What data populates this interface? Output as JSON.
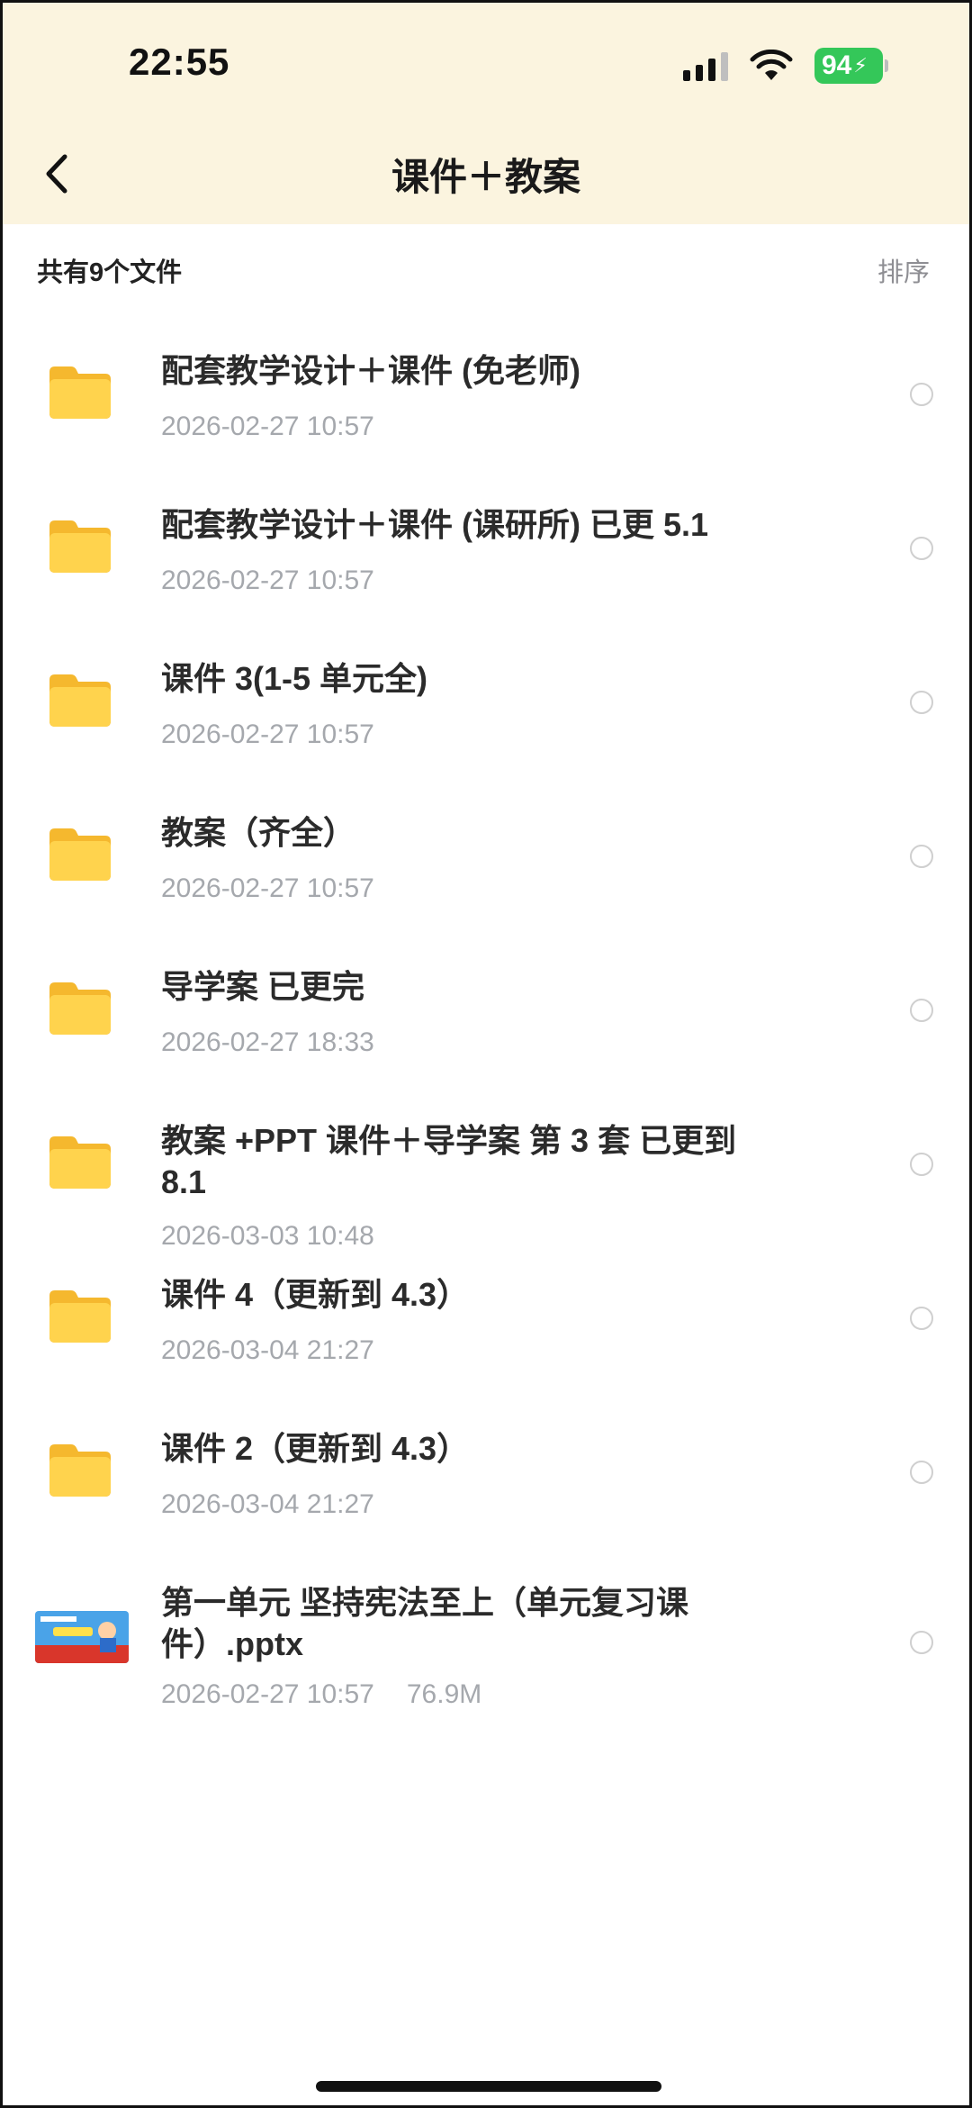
{
  "status": {
    "time": "22:55",
    "battery": "94"
  },
  "nav": {
    "title": "课件＋教案"
  },
  "subheader": {
    "count_text": "共有9个文件",
    "sort_label": "排序"
  },
  "colors": {
    "header_bg": "#fbf4df",
    "folder_yellow": "#ffd34d",
    "battery_green": "#34c759",
    "date_gray": "#a5a8ad"
  },
  "items": [
    {
      "name": "配套教学设计＋课件 (免老师)",
      "date": "2026-02-27 10:57",
      "icon": "folder-icon"
    },
    {
      "name": "配套教学设计＋课件 (课研所) 已更 5.1",
      "date": "2026-02-27 10:57",
      "icon": "folder-icon"
    },
    {
      "name": "课件 3(1-5 单元全)",
      "date": "2026-02-27 10:57",
      "icon": "folder-icon"
    },
    {
      "name": "教案（齐全）",
      "date": "2026-02-27 10:57",
      "icon": "folder-icon"
    },
    {
      "name": "导学案 已更完",
      "date": "2026-02-27 18:33",
      "icon": "folder-icon"
    },
    {
      "name": "教案 +PPT 课件＋导学案 第 3 套 已更到 8.1",
      "date": "2026-03-03 10:48",
      "icon": "folder-icon"
    },
    {
      "name": "课件 4（更新到 4.3）",
      "date": "2026-03-04 21:27",
      "icon": "folder-icon"
    },
    {
      "name": "课件 2（更新到 4.3）",
      "date": "2026-03-04 21:27",
      "icon": "folder-icon"
    },
    {
      "name": "第一单元 坚持宪法至上（单元复习课件）.pptx",
      "date": "2026-02-27 10:57",
      "size": "76.9M",
      "icon": "pptx-thumbnail"
    }
  ]
}
